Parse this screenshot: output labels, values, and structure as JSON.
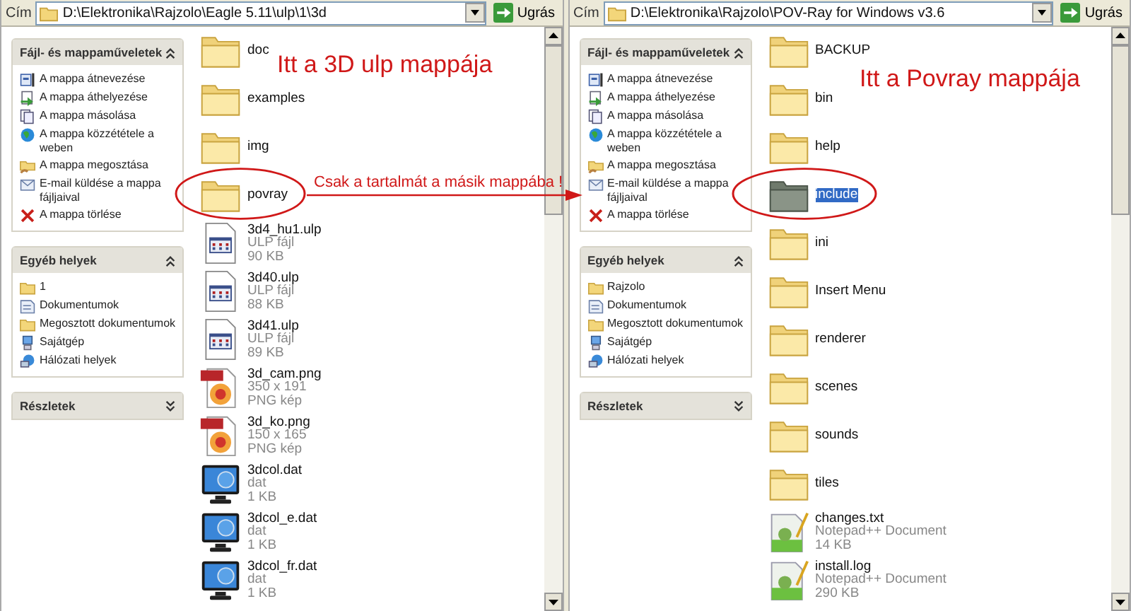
{
  "windows": [
    {
      "address": {
        "label": "Cím",
        "path": "D:\\Elektronika\\Rajzolo\\Eagle 5.11\\ulp\\1\\3d",
        "go_button": "Ugrás"
      },
      "sidebar": [
        {
          "title": "Fájl- és mappaműveletek",
          "expanded": true,
          "items": [
            {
              "label": "A mappa átnevezése",
              "kind": "rename"
            },
            {
              "label": "A mappa áthelyezése",
              "kind": "move"
            },
            {
              "label": "A mappa másolása",
              "kind": "copy"
            },
            {
              "label": "A mappa közzététele a weben",
              "kind": "publish"
            },
            {
              "label": "A mappa megosztása",
              "kind": "share"
            },
            {
              "label": "E-mail küldése a mappa fájljaival",
              "kind": "email"
            },
            {
              "label": "A mappa törlése",
              "kind": "delete"
            }
          ]
        },
        {
          "title": "Egyéb helyek",
          "expanded": true,
          "items": [
            {
              "label": "1",
              "kind": "folder"
            },
            {
              "label": "Dokumentumok",
              "kind": "documents"
            },
            {
              "label": "Megosztott dokumentumok",
              "kind": "folder"
            },
            {
              "label": "Sajátgép",
              "kind": "computer"
            },
            {
              "label": "Hálózati helyek",
              "kind": "network"
            }
          ]
        },
        {
          "title": "Részletek",
          "expanded": false
        }
      ],
      "files": [
        {
          "name": "doc",
          "kind": "folder",
          "selected": false
        },
        {
          "name": "examples",
          "kind": "folder",
          "selected": false
        },
        {
          "name": "img",
          "kind": "folder",
          "selected": false
        },
        {
          "name": "povray",
          "kind": "folder",
          "selected": false
        },
        {
          "name": "3d4_hu1.ulp",
          "kind": "ulp",
          "type": "ULP fájl",
          "size": "90 KB",
          "selected": false
        },
        {
          "name": "3d40.ulp",
          "kind": "ulp",
          "type": "ULP fájl",
          "size": "88 KB",
          "selected": false
        },
        {
          "name": "3d41.ulp",
          "kind": "ulp",
          "type": "ULP fájl",
          "size": "89 KB",
          "selected": false
        },
        {
          "name": "3d_cam.png",
          "kind": "png",
          "type": "350 x 191",
          "size": "PNG kép",
          "selected": false
        },
        {
          "name": "3d_ko.png",
          "kind": "png",
          "type": "150 x 165",
          "size": "PNG kép",
          "selected": false
        },
        {
          "name": "3dcol.dat",
          "kind": "dat",
          "type": "dat",
          "size": "1 KB",
          "selected": false
        },
        {
          "name": "3dcol_e.dat",
          "kind": "dat",
          "type": "dat",
          "size": "1 KB",
          "selected": false
        },
        {
          "name": "3dcol_fr.dat",
          "kind": "dat",
          "type": "dat",
          "size": "1 KB",
          "selected": false
        }
      ]
    },
    {
      "address": {
        "label": "Cím",
        "path": "D:\\Elektronika\\Rajzolo\\POV-Ray for Windows v3.6",
        "go_button": "Ugrás"
      },
      "sidebar": [
        {
          "title": "Fájl- és mappaműveletek",
          "expanded": true,
          "items": [
            {
              "label": "A mappa átnevezése",
              "kind": "rename"
            },
            {
              "label": "A mappa áthelyezése",
              "kind": "move"
            },
            {
              "label": "A mappa másolása",
              "kind": "copy"
            },
            {
              "label": "A mappa közzététele a weben",
              "kind": "publish"
            },
            {
              "label": "A mappa megosztása",
              "kind": "share"
            },
            {
              "label": "E-mail küldése a mappa fájljaival",
              "kind": "email"
            },
            {
              "label": "A mappa törlése",
              "kind": "delete"
            }
          ]
        },
        {
          "title": "Egyéb helyek",
          "expanded": true,
          "items": [
            {
              "label": "Rajzolo",
              "kind": "folder"
            },
            {
              "label": "Dokumentumok",
              "kind": "documents"
            },
            {
              "label": "Megosztott dokumentumok",
              "kind": "folder"
            },
            {
              "label": "Sajátgép",
              "kind": "computer"
            },
            {
              "label": "Hálózati helyek",
              "kind": "network"
            }
          ]
        },
        {
          "title": "Részletek",
          "expanded": false
        }
      ],
      "files": [
        {
          "name": "BACKUP",
          "kind": "folder",
          "selected": false
        },
        {
          "name": "bin",
          "kind": "folder",
          "selected": false
        },
        {
          "name": "help",
          "kind": "folder",
          "selected": false
        },
        {
          "name": "include",
          "kind": "folder",
          "selected": true
        },
        {
          "name": "ini",
          "kind": "folder",
          "selected": false
        },
        {
          "name": "Insert Menu",
          "kind": "folder",
          "selected": false
        },
        {
          "name": "renderer",
          "kind": "folder",
          "selected": false
        },
        {
          "name": "scenes",
          "kind": "folder",
          "selected": false
        },
        {
          "name": "sounds",
          "kind": "folder",
          "selected": false
        },
        {
          "name": "tiles",
          "kind": "folder",
          "selected": false
        },
        {
          "name": "changes.txt",
          "kind": "text",
          "type": "Notepad++ Document",
          "size": "14 KB",
          "selected": false
        },
        {
          "name": "install.log",
          "kind": "text",
          "type": "Notepad++ Document",
          "size": "290 KB",
          "selected": false
        }
      ]
    }
  ],
  "annotations": {
    "left_caption": "Itt a 3D ulp mappája",
    "right_caption": "Itt a Povray mappája",
    "note": "Csak a tartalmát a másik mappába !"
  }
}
